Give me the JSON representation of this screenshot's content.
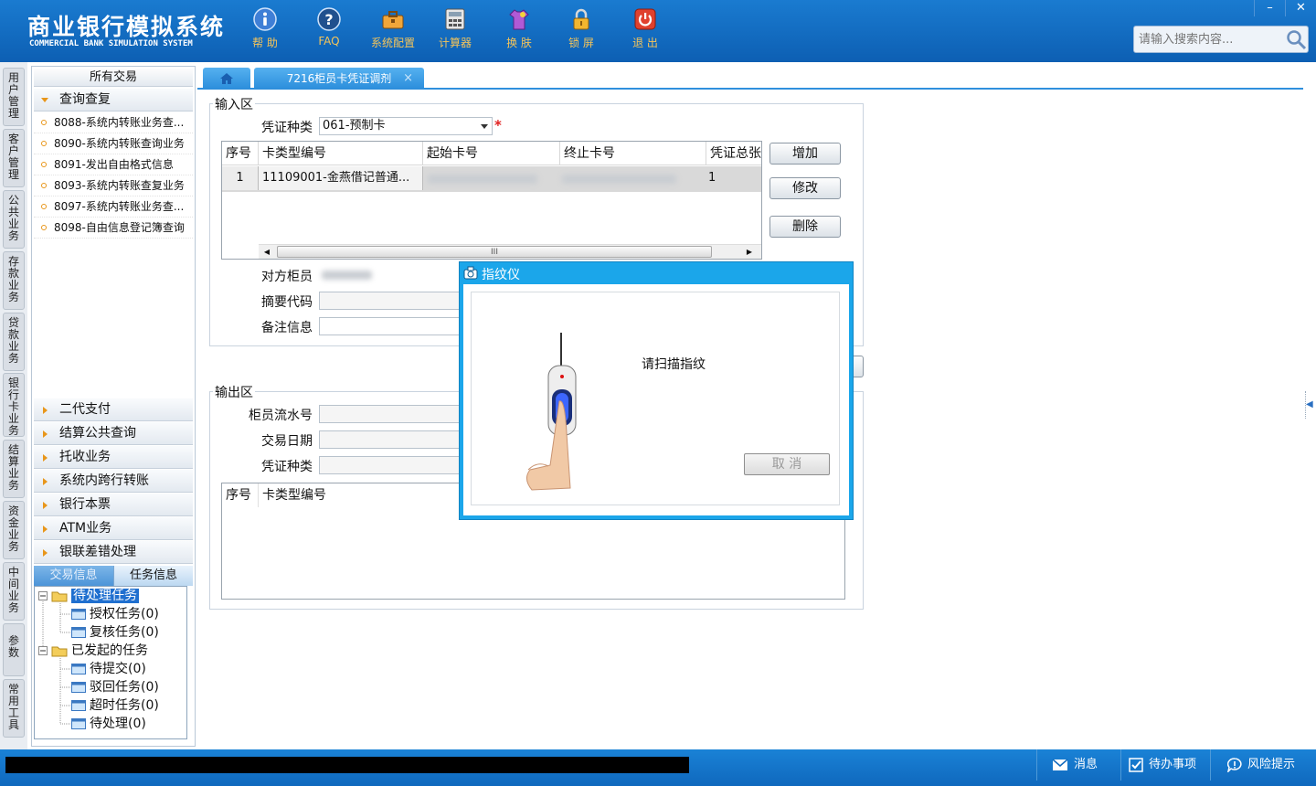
{
  "app": {
    "title_cn": "商业银行模拟系统",
    "title_en": "COMMERCIAL BANK SIMULATION SYSTEM"
  },
  "toolbar": [
    {
      "label": "帮 助",
      "icon": "info-icon"
    },
    {
      "label": "FAQ",
      "icon": "faq-icon"
    },
    {
      "label": "系统配置",
      "icon": "toolbox-icon"
    },
    {
      "label": "计算器",
      "icon": "calculator-icon"
    },
    {
      "label": "换 肤",
      "icon": "shirt-icon"
    },
    {
      "label": "锁 屏",
      "icon": "lock-icon"
    },
    {
      "label": "退 出",
      "icon": "power-icon"
    }
  ],
  "window_controls": {
    "minimize": "–",
    "close": "✕"
  },
  "search": {
    "placeholder": "请输入搜索内容..."
  },
  "vertical_tabs": [
    "用户管理",
    "客户管理",
    "公共业务",
    "存款业务",
    "贷款业务",
    "银行卡业务",
    "结算业务",
    "资金业务",
    "中间业务",
    "参数",
    "常用工具"
  ],
  "left_panel": {
    "header": "所有交易",
    "open_group": "查询查复",
    "open_items": [
      "8088-系统内转账业务查...",
      "8090-系统内转账查询业务",
      "8091-发出自由格式信息",
      "8093-系统内转账查复业务",
      "8097-系统内转账业务查...",
      "8098-自由信息登记簿查询"
    ],
    "groups": [
      "二代支付",
      "结算公共查询",
      "托收业务",
      "系统内跨行转账",
      "银行本票",
      "ATM业务",
      "银联差错处理"
    ],
    "info_tabs": [
      "交易信息",
      "任务信息"
    ],
    "tree": {
      "pending": "待处理任务",
      "pending_children": [
        "授权任务(0)",
        "复核任务(0)"
      ],
      "initiated": "已发起的任务",
      "initiated_children": [
        "待提交(0)",
        "驳回任务(0)",
        "超时任务(0)",
        "待处理(0)"
      ]
    }
  },
  "main_tabs": {
    "active": "7216柜员卡凭证调剂",
    "close": "×"
  },
  "input_section": {
    "title": "输入区",
    "voucher_type_label": "凭证种类",
    "voucher_type_value": "061-预制卡",
    "required_mark": "*",
    "table": {
      "columns": [
        "序号",
        "卡类型编号",
        "起始卡号",
        "终止卡号",
        "凭证总张数"
      ],
      "rows": [
        {
          "no": "1",
          "card_type": "11109001-金燕借记普通...",
          "total": "1"
        }
      ]
    },
    "scroll_mark": "III",
    "buttons": {
      "add": "增加",
      "modify": "修改",
      "delete": "删除"
    },
    "counter_teller_label": "对方柜员",
    "summary_code_label": "摘要代码",
    "remark_label": "备注信息"
  },
  "output_section": {
    "title": "输出区",
    "teller_serial_label": "柜员流水号",
    "trade_date_label": "交易日期",
    "voucher_type_label": "凭证种类",
    "table": {
      "columns": [
        "序号",
        "卡类型编号"
      ]
    }
  },
  "dialog": {
    "title": "指纹仪",
    "message": "请扫描指纹",
    "cancel": "取 消"
  },
  "statusbar": {
    "messages": "消息",
    "todo": "待办事项",
    "risk": "风险提示"
  }
}
